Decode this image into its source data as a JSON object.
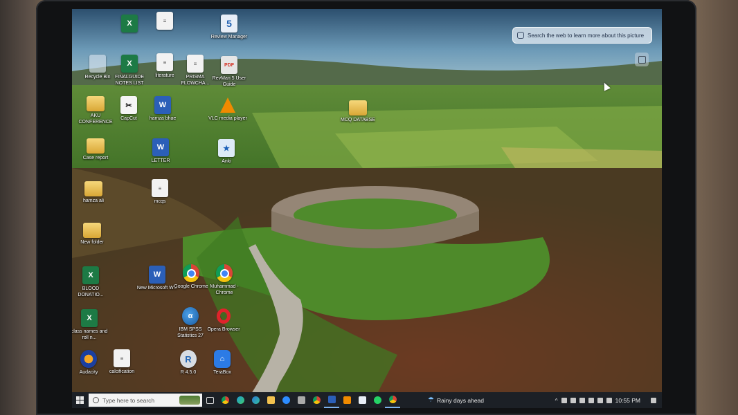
{
  "web_search": {
    "label": "Search the web to learn more about this picture"
  },
  "desktop_icons": [
    {
      "id": "recycle-bin",
      "label": "Recycle Bin",
      "kind": "recycle"
    },
    {
      "id": "folder-aku",
      "label": "AKU CONFERENCE",
      "kind": "folder"
    },
    {
      "id": "folder-case",
      "label": "Case report",
      "kind": "folder"
    },
    {
      "id": "folder-hamza",
      "label": "hamza ali",
      "kind": "folder"
    },
    {
      "id": "folder-new",
      "label": "New folder",
      "kind": "folder"
    },
    {
      "id": "excel-blood",
      "label": "BLOOD DONATIO...",
      "kind": "excel"
    },
    {
      "id": "excel-class",
      "label": "class names and roll n...",
      "kind": "excel"
    },
    {
      "id": "audacity",
      "label": "Audacity",
      "kind": "audacity"
    },
    {
      "id": "excel-top",
      "label": "",
      "kind": "excel"
    },
    {
      "id": "excel-notes",
      "label": "FINALGUIDE NOTES LIST",
      "kind": "excel"
    },
    {
      "id": "capcut",
      "label": "CapCut",
      "kind": "capcut"
    },
    {
      "id": "doc-top",
      "label": "",
      "kind": "doc"
    },
    {
      "id": "doc-literature",
      "label": "literature",
      "kind": "doc"
    },
    {
      "id": "word-hamza",
      "label": "hamza bhae",
      "kind": "word"
    },
    {
      "id": "word-letter",
      "label": "LETTER",
      "kind": "word"
    },
    {
      "id": "doc-mcqs",
      "label": "mcqs",
      "kind": "doc"
    },
    {
      "id": "word-new",
      "label": "New Microsoft W...",
      "kind": "word"
    },
    {
      "id": "doc-calcification",
      "label": "calcification",
      "kind": "doc"
    },
    {
      "id": "prisma",
      "label": "PRISMA FLOWCHA...",
      "kind": "doc"
    },
    {
      "id": "chrome-google",
      "label": "Google Chrome",
      "kind": "chrome"
    },
    {
      "id": "spss",
      "label": "IBM SPSS Statistics 27",
      "kind": "spss"
    },
    {
      "id": "r-450",
      "label": "R 4.5.0",
      "kind": "r"
    },
    {
      "id": "five",
      "label": "Review Manager",
      "kind": "five"
    },
    {
      "id": "revman-pdf",
      "label": "RevMan 5 User Guide",
      "kind": "pdf"
    },
    {
      "id": "vlc",
      "label": "VLC media player",
      "kind": "vlc"
    },
    {
      "id": "anki",
      "label": "Anki",
      "kind": "anki"
    },
    {
      "id": "chrome-muhammad",
      "label": "Muhammad - Chrome",
      "kind": "chrome"
    },
    {
      "id": "opera",
      "label": "Opera Browser",
      "kind": "opera"
    },
    {
      "id": "terabox",
      "label": "TeraBox",
      "kind": "terabox"
    },
    {
      "id": "folder-mcq",
      "label": "MCQ DATABSE",
      "kind": "folder"
    }
  ],
  "taskbar": {
    "search_placeholder": "Type here to search",
    "weather": "Rainy days ahead",
    "clock": "10:55 PM",
    "apps": [
      "task-view",
      "chrome",
      "edge",
      "edge-alt",
      "file-explorer",
      "zoom",
      "store",
      "chrome-taskbar",
      "word",
      "vlc",
      "five",
      "whatsapp",
      "chrome-active"
    ]
  },
  "colors": {
    "taskbar": "#1c2026",
    "accent": "#7db3ef"
  }
}
